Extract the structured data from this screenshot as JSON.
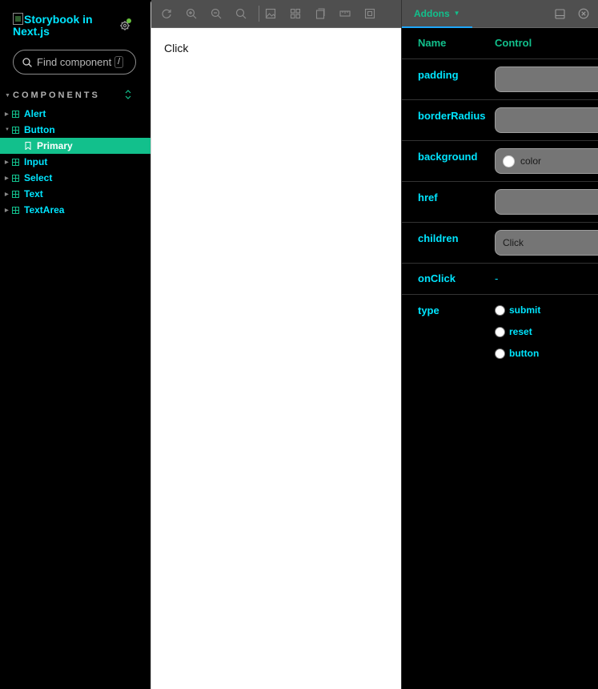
{
  "sidebar": {
    "brand": "Storybook in Next.js",
    "search": {
      "placeholder": "Find components",
      "shortcut": "/"
    },
    "section_title": "COMPONENTS",
    "items": [
      {
        "label": "Alert"
      },
      {
        "label": "Button"
      },
      {
        "label": "Primary"
      },
      {
        "label": "Input"
      },
      {
        "label": "Select"
      },
      {
        "label": "Text"
      },
      {
        "label": "TextArea"
      }
    ]
  },
  "preview": {
    "button_text": "Click"
  },
  "panel": {
    "tab_label": "Addons",
    "columns": {
      "name": "Name",
      "control": "Control"
    },
    "args": {
      "padding": "padding",
      "borderRadius": "borderRadius",
      "background": "background",
      "background_value": "color",
      "href": "href",
      "children": "children",
      "children_value": "Click",
      "onClick": "onClick",
      "onClick_value": "-",
      "type": "type",
      "type_options": [
        "submit",
        "reset",
        "button"
      ]
    }
  },
  "icons": [
    "settings-icon",
    "search-icon",
    "component-icon",
    "bookmark-icon",
    "reload-icon",
    "zoom-in-icon",
    "zoom-out-icon",
    "zoom-reset-icon",
    "background-icon",
    "grid-icon",
    "viewport-icon",
    "measure-icon",
    "outline-icon",
    "layout-icon",
    "close-icon"
  ],
  "colors": {
    "accent": "#12c08c",
    "cyan_text": "#00e5ff",
    "tab_underline": "#1ea7fd",
    "status_dot": "#66bf3c"
  }
}
